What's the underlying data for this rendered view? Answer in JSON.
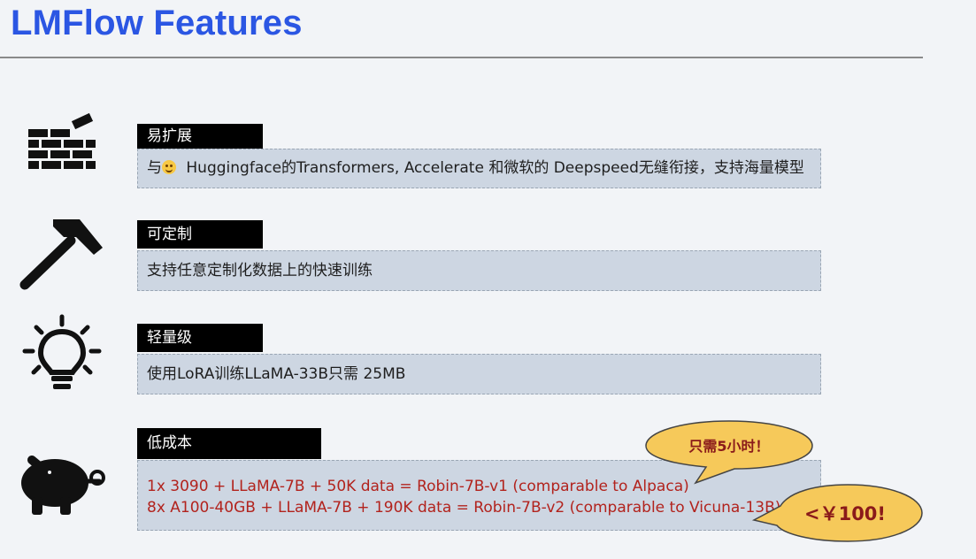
{
  "slide": {
    "title": "LMFlow Features"
  },
  "features": [
    {
      "icon": "brick-wall-icon",
      "tag": "易扩展",
      "text_before": "与",
      "emoji": "hugging-face-emoji-icon",
      "text_after": " Huggingface的Transformers, Accelerate 和微软的 Deepspeed无缝衔接，支持海量模型"
    },
    {
      "icon": "hammer-icon",
      "tag": "可定制",
      "text": "支持任意定制化数据上的快速训练"
    },
    {
      "icon": "lightbulb-icon",
      "tag": "轻量级",
      "text": "使用LoRA训练LLaMA-33B只需 25MB"
    },
    {
      "icon": "piggy-bank-icon",
      "tag": "低成本",
      "lines": [
        "1x 3090 + LLaMA-7B + 50K data = Robin-7B-v1 (comparable to Alpaca)",
        "8x A100-40GB + LLaMA-7B + 190K data = Robin-7B-v2 (comparable to Vicuna-13B)"
      ]
    }
  ],
  "callouts": {
    "time": "只需5小时！",
    "cost": "<￥100!"
  },
  "colors": {
    "title": "#2b56e3",
    "tag_bg": "#000000",
    "box_bg": "#cdd6e2",
    "highlight_text": "#b2231d",
    "bubble_fill": "#f6c95a"
  }
}
